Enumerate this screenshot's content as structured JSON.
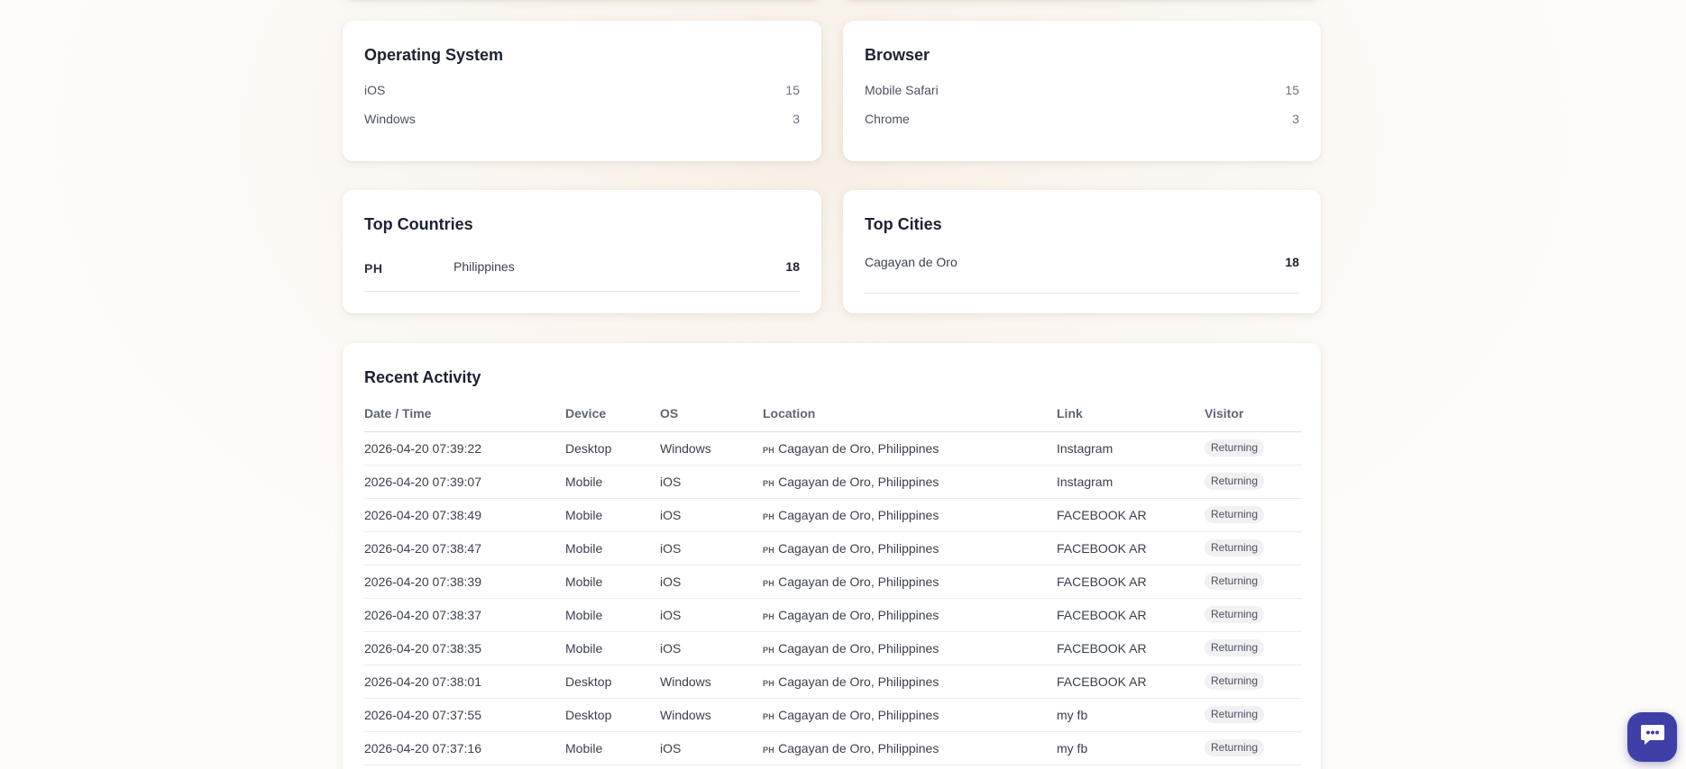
{
  "os": {
    "title": "Operating System",
    "items": [
      {
        "label": "iOS",
        "value": "15"
      },
      {
        "label": "Windows",
        "value": "3"
      }
    ]
  },
  "browser": {
    "title": "Browser",
    "items": [
      {
        "label": "Mobile Safari",
        "value": "15"
      },
      {
        "label": "Chrome",
        "value": "3"
      }
    ]
  },
  "countries": {
    "title": "Top Countries",
    "items": [
      {
        "code": "PH",
        "name": "Philippines",
        "count": "18"
      }
    ]
  },
  "cities": {
    "title": "Top Cities",
    "items": [
      {
        "name": "Cagayan de Oro",
        "count": "18"
      }
    ]
  },
  "activity": {
    "title": "Recent Activity",
    "columns": [
      "Date / Time",
      "Device",
      "OS",
      "Location",
      "Link",
      "Visitor"
    ],
    "rows": [
      {
        "datetime": "2026-04-20 07:39:22",
        "device": "Desktop",
        "os": "Windows",
        "flag": "PH",
        "location": "Cagayan de Oro, Philippines",
        "link": "Instagram",
        "visitor": "Returning"
      },
      {
        "datetime": "2026-04-20 07:39:07",
        "device": "Mobile",
        "os": "iOS",
        "flag": "PH",
        "location": "Cagayan de Oro, Philippines",
        "link": "Instagram",
        "visitor": "Returning"
      },
      {
        "datetime": "2026-04-20 07:38:49",
        "device": "Mobile",
        "os": "iOS",
        "flag": "PH",
        "location": "Cagayan de Oro, Philippines",
        "link": "FACEBOOK AR",
        "visitor": "Returning"
      },
      {
        "datetime": "2026-04-20 07:38:47",
        "device": "Mobile",
        "os": "iOS",
        "flag": "PH",
        "location": "Cagayan de Oro, Philippines",
        "link": "FACEBOOK AR",
        "visitor": "Returning"
      },
      {
        "datetime": "2026-04-20 07:38:39",
        "device": "Mobile",
        "os": "iOS",
        "flag": "PH",
        "location": "Cagayan de Oro, Philippines",
        "link": "FACEBOOK AR",
        "visitor": "Returning"
      },
      {
        "datetime": "2026-04-20 07:38:37",
        "device": "Mobile",
        "os": "iOS",
        "flag": "PH",
        "location": "Cagayan de Oro, Philippines",
        "link": "FACEBOOK AR",
        "visitor": "Returning"
      },
      {
        "datetime": "2026-04-20 07:38:35",
        "device": "Mobile",
        "os": "iOS",
        "flag": "PH",
        "location": "Cagayan de Oro, Philippines",
        "link": "FACEBOOK AR",
        "visitor": "Returning"
      },
      {
        "datetime": "2026-04-20 07:38:01",
        "device": "Desktop",
        "os": "Windows",
        "flag": "PH",
        "location": "Cagayan de Oro, Philippines",
        "link": "FACEBOOK AR",
        "visitor": "Returning"
      },
      {
        "datetime": "2026-04-20 07:37:55",
        "device": "Desktop",
        "os": "Windows",
        "flag": "PH",
        "location": "Cagayan de Oro, Philippines",
        "link": "my fb",
        "visitor": "Returning"
      },
      {
        "datetime": "2026-04-20 07:37:16",
        "device": "Mobile",
        "os": "iOS",
        "flag": "PH",
        "location": "Cagayan de Oro, Philippines",
        "link": "my fb",
        "visitor": "Returning"
      }
    ]
  },
  "chat": {
    "icon": "chat-icon",
    "color": "#3f3fa8"
  }
}
